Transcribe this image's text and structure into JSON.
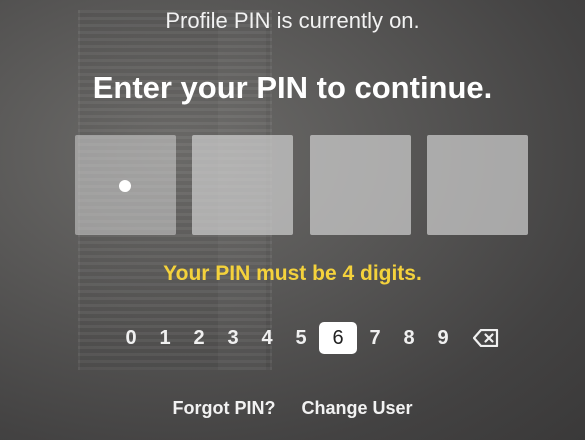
{
  "status_text": "Profile PIN is currently on.",
  "title": "Enter your PIN to continue.",
  "pin": {
    "length": 4,
    "entered": 1
  },
  "error_text": "Your PIN must be 4 digits.",
  "keypad": {
    "keys": [
      "0",
      "1",
      "2",
      "3",
      "4",
      "5",
      "6",
      "7",
      "8",
      "9"
    ],
    "selected": "6",
    "delete_icon": "backspace-icon"
  },
  "footer": {
    "forgot_label": "Forgot PIN?",
    "change_user_label": "Change User"
  },
  "colors": {
    "error": "#f4d23c",
    "selected_key_bg": "#ffffff",
    "text": "#ffffff"
  }
}
